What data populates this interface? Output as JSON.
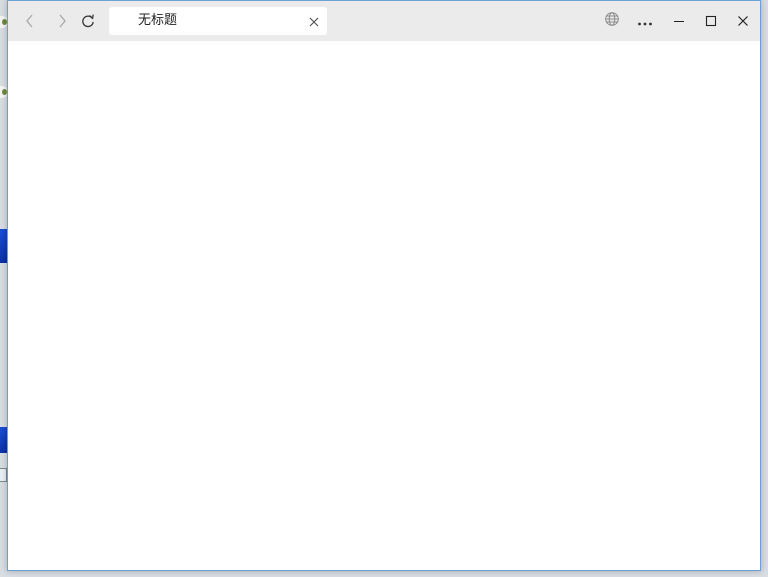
{
  "window": {
    "tab_title": "无标题"
  },
  "icons": {
    "back": "chevron-left-icon",
    "forward": "chevron-right-icon",
    "refresh": "refresh-icon",
    "tab_close": "close-icon",
    "language": "globe-icon",
    "more": "more-horizontal-icon",
    "minimize": "minimize-icon",
    "maximize": "maximize-icon",
    "close": "close-icon"
  },
  "colors": {
    "titlebar": "#ebebeb",
    "tab": "#ffffff",
    "window_border": "#6ea0d8",
    "content": "#ffffff"
  }
}
